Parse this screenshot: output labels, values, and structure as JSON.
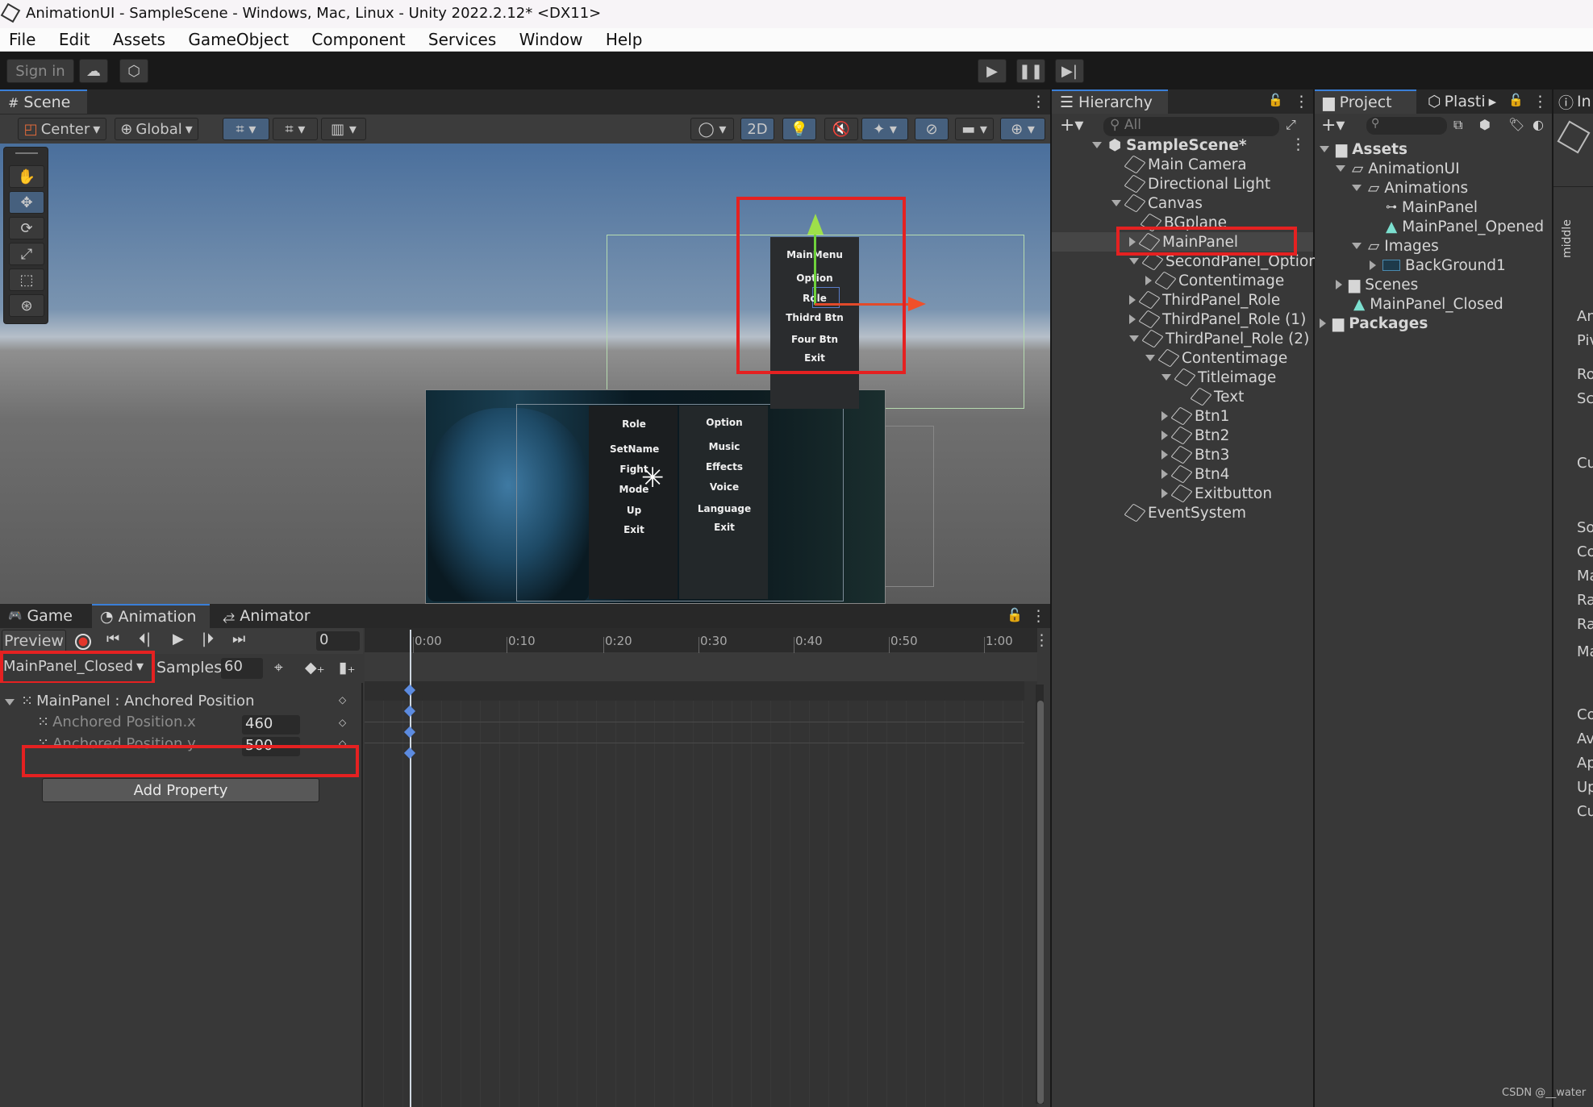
{
  "window": {
    "title": "AnimationUI - SampleScene - Windows, Mac, Linux - Unity 2022.2.12* <DX11>"
  },
  "menu": {
    "items": [
      "File",
      "Edit",
      "Assets",
      "GameObject",
      "Component",
      "Services",
      "Window",
      "Help"
    ]
  },
  "toolbar": {
    "sign_in": "Sign in"
  },
  "scene": {
    "tab": "Scene",
    "pivot": "Center",
    "space": "Global",
    "mode2d": "2D",
    "main_menu": [
      "MainMenu",
      "Option",
      "Role",
      "Thidrd Btn",
      "Four Btn",
      "Exit"
    ],
    "col1": [
      "Role",
      "SetName",
      "Fight",
      "Mode",
      "Up",
      "Exit"
    ],
    "col2": [
      "Option",
      "Music",
      "Effects",
      "Voice",
      "Language",
      "Exit"
    ]
  },
  "hierarchy": {
    "tab": "Hierarchy",
    "search_placeholder": "All",
    "scene_name": "SampleScene*",
    "items": [
      "Main Camera",
      "Directional Light",
      "Canvas",
      "BGplane",
      "MainPanel",
      "SecondPanel_Option",
      "Contentimage",
      "ThirdPanel_Role",
      "ThirdPanel_Role (1)",
      "ThirdPanel_Role (2)",
      "Contentimage",
      "Titleimage",
      "Text",
      "Btn1",
      "Btn2",
      "Btn3",
      "Btn4",
      "Exitbutton",
      "EventSystem"
    ]
  },
  "project": {
    "tab": "Project",
    "tab2": "Plasti",
    "items": [
      "Assets",
      "AnimationUI",
      "Animations",
      "MainPanel",
      "MainPanel_Opened",
      "Images",
      "BackGround1",
      "Scenes",
      "MainPanel_Closed",
      "Packages"
    ]
  },
  "inspector": {
    "tab": "In",
    "labels": [
      "middle",
      "An",
      "Piv",
      "Ro",
      "Sc",
      "Cu",
      "So",
      "Co",
      "Ma",
      "Ra",
      "Ra",
      "Ma",
      "Co",
      "Av",
      "Ap",
      "Up",
      "Cu"
    ]
  },
  "animation": {
    "tabs": [
      "Game",
      "Animation",
      "Animator"
    ],
    "preview": "Preview",
    "frame": "0",
    "clip": "MainPanel_Closed",
    "samples_label": "Samples",
    "samples": "60",
    "property_group": "MainPanel : Anchored Position",
    "properties": [
      {
        "name": "Anchored Position.x",
        "value": "460"
      },
      {
        "name": "Anchored Position.y",
        "value": "500"
      }
    ],
    "add_property": "Add Property",
    "timeline": [
      "0:00",
      "0:10",
      "0:20",
      "0:30",
      "0:40",
      "0:50",
      "1:00"
    ]
  },
  "watermark": "CSDN @__water"
}
